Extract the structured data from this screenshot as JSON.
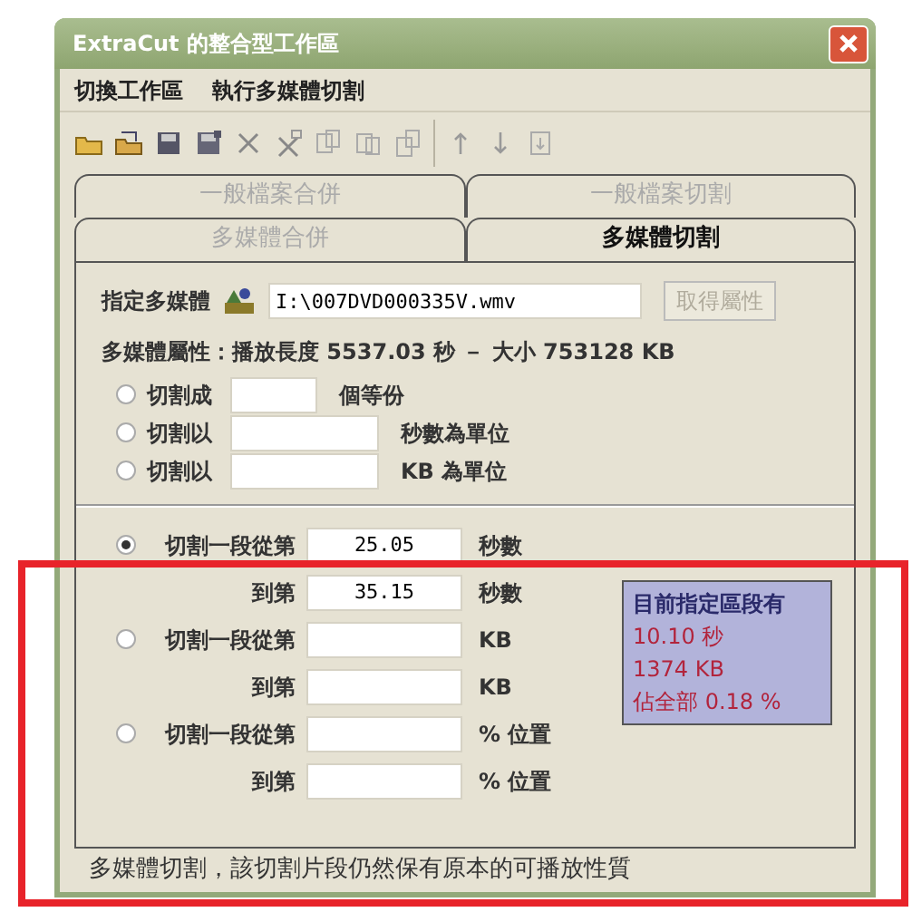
{
  "window": {
    "title": "ExtraCut 的整合型工作區"
  },
  "menu": [
    "切換工作區",
    "執行多媒體切割"
  ],
  "tabs": [
    [
      {
        "label": "一般檔案合併",
        "selected": false
      },
      {
        "label": "一般檔案切割",
        "selected": false
      }
    ],
    [
      {
        "label": "多媒體合併",
        "selected": false
      },
      {
        "label": "多媒體切割",
        "selected": true
      }
    ]
  ],
  "media": {
    "label": "指定多媒體",
    "path": "I:\\007DVD000335V.wmv",
    "button": {
      "label": "取得屬性",
      "disabled": true
    }
  },
  "properties": "多媒體屬性：播放長度 5537.03 秒 － 大小 753128 KB",
  "split_options": [
    {
      "label": "切割成",
      "unit": "個等份",
      "selected": false,
      "kind": "short"
    },
    {
      "label": "切割以",
      "unit": "秒數為單位",
      "selected": false,
      "kind": "long"
    },
    {
      "label": "切割以",
      "unit": "KB 為單位",
      "selected": false,
      "kind": "long"
    }
  ],
  "segments": [
    {
      "label": "切割一段從第",
      "from": "25.05",
      "from_unit": "秒數",
      "to_label": "到第",
      "to": "35.15",
      "to_unit": "秒數",
      "selected": true
    },
    {
      "label": "切割一段從第",
      "from_unit": "KB",
      "to_label": "到第",
      "to_unit": "KB",
      "selected": false
    },
    {
      "label": "切割一段從第",
      "from_unit": "% 位置",
      "to_label": "到第",
      "to_unit": "% 位置",
      "selected": false
    }
  ],
  "info": {
    "title": "目前指定區段有",
    "lines": [
      "10.10 秒",
      "1374 KB",
      "佔全部 0.18 %"
    ]
  },
  "status": "多媒體切割，該切割片段仍然保有原本的可播放性質",
  "highlight_frame": {
    "shown": true
  }
}
